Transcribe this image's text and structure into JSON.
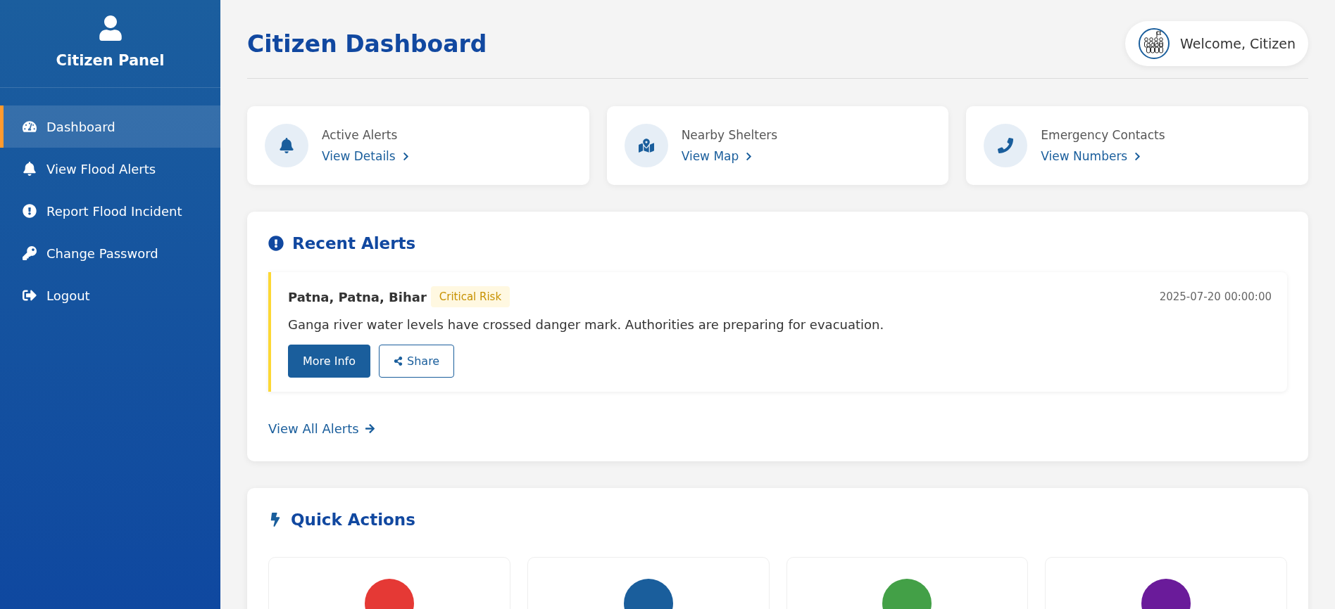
{
  "sidebar": {
    "title": "Citizen Panel",
    "items": [
      {
        "label": "Dashboard",
        "selected": true
      },
      {
        "label": "View Flood Alerts",
        "selected": false
      },
      {
        "label": "Report Flood Incident",
        "selected": false
      },
      {
        "label": "Change Password",
        "selected": false
      },
      {
        "label": "Logout",
        "selected": false
      }
    ]
  },
  "header": {
    "title": "Citizen Dashboard",
    "welcome": "Welcome, Citizen"
  },
  "stats": [
    {
      "title": "Active Alerts",
      "link": "View Details"
    },
    {
      "title": "Nearby Shelters",
      "link": "View Map"
    },
    {
      "title": "Emergency Contacts",
      "link": "View Numbers"
    }
  ],
  "recent_alerts": {
    "title": "Recent Alerts",
    "alerts": [
      {
        "location": "Patna, Patna, Bihar",
        "risk": "Critical Risk",
        "time": "2025-07-20 00:00:00",
        "message": "Ganga river water levels have crossed danger mark. Authorities are preparing for evacuation.",
        "buttons": [
          "More Info",
          "Share"
        ]
      }
    ],
    "view_all": "View All Alerts"
  },
  "quick_actions": {
    "title": "Quick Actions",
    "items": [
      {
        "color": "#e53935"
      },
      {
        "color": "#1a5e9c"
      },
      {
        "color": "#43a047"
      },
      {
        "color": "#6a1b9a"
      }
    ]
  }
}
